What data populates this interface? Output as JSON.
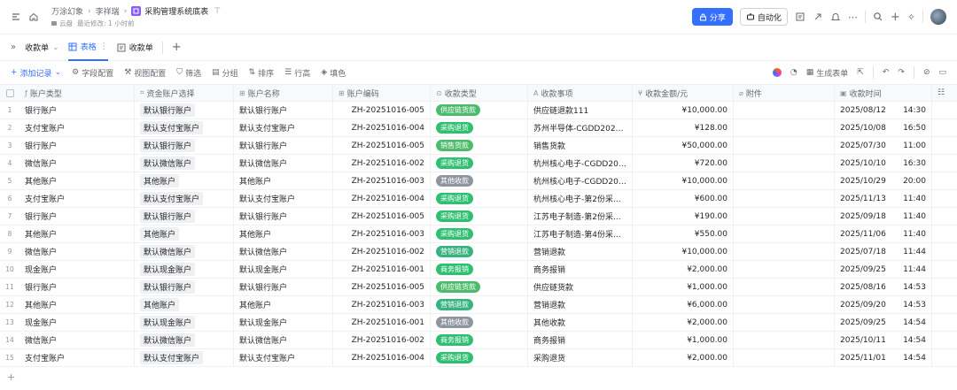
{
  "breadcrumb": {
    "workspace": "万涂幻象",
    "owner": "李祥瑞",
    "document": "采购管理系统底表",
    "location": "云盘",
    "modified": "最近修改: 1 小时前"
  },
  "header": {
    "share": "分享",
    "automation": "自动化"
  },
  "tabs": [
    {
      "label": "收款单"
    },
    {
      "label": "表格"
    },
    {
      "label": "收款单"
    }
  ],
  "toolbar": {
    "add_record": "添加记录",
    "field_config": "字段配置",
    "view_config": "视图配置",
    "filter": "筛选",
    "group": "分组",
    "sort": "排序",
    "row_height": "行高",
    "fill": "填色",
    "generate_form": "生成表单"
  },
  "columns": [
    "账户类型",
    "资金账户选择",
    "账户名称",
    "账户编码",
    "收款类型",
    "收款事项",
    "收款金额/元",
    "附件",
    "收款时间"
  ],
  "type_colors": {
    "供应链货款": "#4cbb6c",
    "采购退货": "#2fbf71",
    "销售货款": "#4cbb6c",
    "其他收款": "#8f959e",
    "营销退款": "#36b37e",
    "商务报销": "#2fbf71"
  },
  "rows": [
    {
      "n": "1",
      "type": "银行账户",
      "acct": "默认银行账户",
      "name": "默认银行账户",
      "code": "ZH-20251016-005",
      "rtype": "供应链货款",
      "item": "供应链退款111",
      "amount": "¥10,000.00",
      "date": "2025/08/12",
      "time": "14:30"
    },
    {
      "n": "2",
      "type": "支付宝账户",
      "acct": "默认支付宝账户",
      "name": "默认支付宝账户",
      "code": "ZH-20251016-004",
      "rtype": "采购退货",
      "item": "苏州半导体-CGDD20251...",
      "amount": "¥128.00",
      "date": "2025/10/08",
      "time": "16:50"
    },
    {
      "n": "3",
      "type": "银行账户",
      "acct": "默认银行账户",
      "name": "默认银行账户",
      "code": "ZH-20251016-005",
      "rtype": "销售货款",
      "item": "销售货款",
      "amount": "¥50,000.00",
      "date": "2025/07/30",
      "time": "11:00"
    },
    {
      "n": "4",
      "type": "微信账户",
      "acct": "默认微信账户",
      "name": "默认微信账户",
      "code": "ZH-20251016-002",
      "rtype": "采购退货",
      "item": "杭州核心电子-CGDD202...",
      "amount": "¥720.00",
      "date": "2025/10/10",
      "time": "16:30"
    },
    {
      "n": "5",
      "type": "其他账户",
      "acct": "其他账户",
      "name": "其他账户",
      "code": "ZH-20251016-003",
      "rtype": "其他收款",
      "item": "杭州核心电子-CGDD202...",
      "amount": "¥10,000.00",
      "date": "2025/10/29",
      "time": "20:00"
    },
    {
      "n": "6",
      "type": "支付宝账户",
      "acct": "默认支付宝账户",
      "name": "默认支付宝账户",
      "code": "ZH-20251016-004",
      "rtype": "采购退货",
      "item": "杭州核心电子-第2份采...",
      "amount": "¥600.00",
      "date": "2025/11/13",
      "time": "11:40"
    },
    {
      "n": "7",
      "type": "银行账户",
      "acct": "默认银行账户",
      "name": "默认银行账户",
      "code": "ZH-20251016-005",
      "rtype": "采购退货",
      "item": "江苏电子制造-第2份采...",
      "amount": "¥190.00",
      "date": "2025/09/18",
      "time": "11:40"
    },
    {
      "n": "8",
      "type": "其他账户",
      "acct": "其他账户",
      "name": "其他账户",
      "code": "ZH-20251016-003",
      "rtype": "采购退货",
      "item": "江苏电子制造-第4份采...",
      "amount": "¥550.00",
      "date": "2025/11/06",
      "time": "11:40"
    },
    {
      "n": "9",
      "type": "微信账户",
      "acct": "默认微信账户",
      "name": "默认微信账户",
      "code": "ZH-20251016-002",
      "rtype": "营销退款",
      "item": "营销退款",
      "amount": "¥10,000.00",
      "date": "2025/07/18",
      "time": "11:44"
    },
    {
      "n": "10",
      "type": "现金账户",
      "acct": "默认现金账户",
      "name": "默认现金账户",
      "code": "ZH-20251016-001",
      "rtype": "商务报销",
      "item": "商务报销",
      "amount": "¥2,000.00",
      "date": "2025/09/25",
      "time": "11:44"
    },
    {
      "n": "11",
      "type": "银行账户",
      "acct": "默认银行账户",
      "name": "默认银行账户",
      "code": "ZH-20251016-005",
      "rtype": "供应链货款",
      "item": "供应链货款",
      "amount": "¥1,000.00",
      "date": "2025/08/16",
      "time": "14:53"
    },
    {
      "n": "12",
      "type": "其他账户",
      "acct": "其他账户",
      "name": "其他账户",
      "code": "ZH-20251016-003",
      "rtype": "营销退款",
      "item": "营销退款",
      "amount": "¥6,000.00",
      "date": "2025/09/20",
      "time": "14:53"
    },
    {
      "n": "13",
      "type": "现金账户",
      "acct": "默认现金账户",
      "name": "默认现金账户",
      "code": "ZH-20251016-001",
      "rtype": "其他收款",
      "item": "其他收款",
      "amount": "¥2,000.00",
      "date": "2025/09/25",
      "time": "14:54"
    },
    {
      "n": "14",
      "type": "微信账户",
      "acct": "默认微信账户",
      "name": "默认微信账户",
      "code": "ZH-20251016-002",
      "rtype": "商务报销",
      "item": "商务报销",
      "amount": "¥1,000.00",
      "date": "2025/10/11",
      "time": "14:54"
    },
    {
      "n": "15",
      "type": "支付宝账户",
      "acct": "默认支付宝账户",
      "name": "默认支付宝账户",
      "code": "ZH-20251016-004",
      "rtype": "采购退货",
      "item": "采购退货",
      "amount": "¥2,000.00",
      "date": "2025/11/01",
      "time": "14:54"
    }
  ]
}
